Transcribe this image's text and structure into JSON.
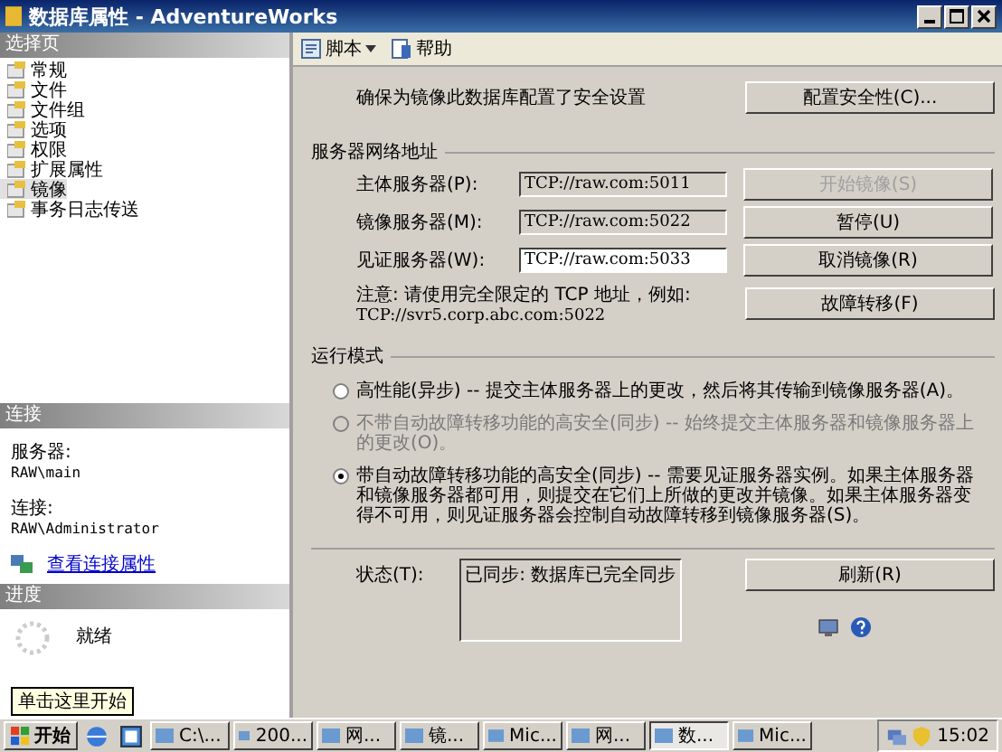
{
  "window": {
    "title": "数据库属性 - AdventureWorks"
  },
  "sidebar": {
    "header": "选择页",
    "items": [
      {
        "label": "常规",
        "selected": false
      },
      {
        "label": "文件",
        "selected": false
      },
      {
        "label": "文件组",
        "selected": false
      },
      {
        "label": "选项",
        "selected": false
      },
      {
        "label": "权限",
        "selected": false
      },
      {
        "label": "扩展属性",
        "selected": false
      },
      {
        "label": "镜像",
        "selected": true
      },
      {
        "label": "事务日志传送",
        "selected": false
      }
    ],
    "connection": {
      "header": "连接",
      "server_label": "服务器:",
      "server": "RAW\\main",
      "user_label": "连接:",
      "user": "RAW\\Administrator",
      "link": "查看连接属性"
    },
    "progress": {
      "header": "进度",
      "status": "就绪"
    }
  },
  "toolbar": [
    {
      "kind": "script",
      "label": "脚本"
    },
    {
      "kind": "help",
      "label": "帮助"
    }
  ],
  "security": {
    "text": "确保为镜像此数据库配置了安全设置",
    "button": "配置安全性(C)..."
  },
  "network": {
    "title": "服务器网络地址",
    "rows": [
      {
        "label": "主体服务器(P):",
        "value": "TCP://raw.com:5011",
        "readonly": true,
        "button": "开始镜像(S)",
        "disabled": true
      },
      {
        "label": "镜像服务器(M):",
        "value": "TCP://raw.com:5022",
        "readonly": true,
        "button": "暂停(U)",
        "disabled": false
      },
      {
        "label": "见证服务器(W):",
        "value": "TCP://raw.com:5033",
        "readonly": false,
        "button": "取消镜像(R)",
        "disabled": false
      }
    ],
    "note": [
      "注意: 请使用完全限定的 TCP 地址，例如:",
      "TCP://svr5.corp.abc.com:5022"
    ],
    "failover": "故障转移(F)"
  },
  "mode": {
    "title": "运行模式",
    "options": [
      {
        "label": "高性能(异步) -- 提交主体服务器上的更改，然后将其传输到镜像服务器(A)。",
        "selected": false,
        "disabled": false
      },
      {
        "label": "不带自动故障转移功能的高安全(同步) -- 始终提交主体服务器和镜像服务器上的更改(O)。",
        "selected": false,
        "disabled": true
      },
      {
        "label": "带自动故障转移功能的高安全(同步) -- 需要见证服务器实例。如果主体服务器和镜像服务器都可用，则提交在它们上所做的更改并镜像。如果主体服务器变得不可用，则见证服务器会控制自动故障转移到镜像服务器(S)。",
        "selected": true,
        "disabled": false
      }
    ]
  },
  "status": {
    "label": "状态(T):",
    "value": "已同步: 数据库已完全同步",
    "button": "刷新(R)"
  },
  "taskbar": {
    "start": "开始",
    "tooltip": "单击这里开始",
    "tasks": [
      {
        "label": "C:\\...",
        "selected": false
      },
      {
        "label": "200...",
        "selected": false
      },
      {
        "label": "网...",
        "selected": false
      },
      {
        "label": "镜...",
        "selected": false
      },
      {
        "label": "Mic...",
        "selected": false
      },
      {
        "label": "网...",
        "selected": false
      },
      {
        "label": "数...",
        "selected": true
      },
      {
        "label": "Mic...",
        "selected": false
      }
    ],
    "clock": "15:02"
  }
}
